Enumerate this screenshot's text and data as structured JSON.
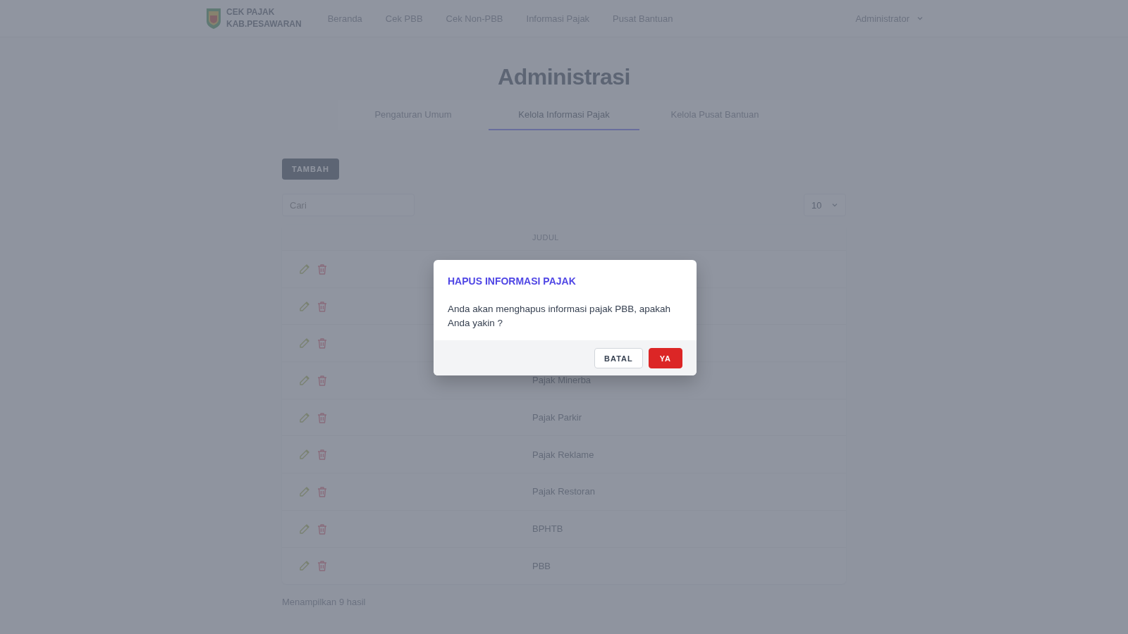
{
  "navbar": {
    "brand": [
      "CEK PAJAK",
      "KAB.PESAWARAN"
    ],
    "links": [
      "Beranda",
      "Cek PBB",
      "Cek Non-PBB",
      "Informasi Pajak",
      "Pusat Bantuan"
    ],
    "user": "Administrator"
  },
  "page_title": "Administrasi",
  "tabs": [
    {
      "label": "Pengaturan Umum",
      "selected": false
    },
    {
      "label": "Kelola Informasi Pajak",
      "selected": true
    },
    {
      "label": "Kelola Pusat Bantuan",
      "selected": false
    }
  ],
  "add_button": "TAMBAH",
  "search": {
    "placeholder": "Cari"
  },
  "page_size": "10",
  "table": {
    "columns": [
      "JUDUL"
    ],
    "rows": [
      {},
      {},
      {},
      {
        "title": "Pajak Minerba"
      },
      {
        "title": "Pajak Parkir"
      },
      {
        "title": "Pajak Reklame"
      },
      {
        "title": "Pajak Restoran"
      },
      {
        "title": "BPHTB"
      },
      {
        "title": "PBB"
      }
    ]
  },
  "result_count": "Menampilkan 9 hasil",
  "dialog": {
    "title": "HAPUS INFORMASI PAJAK",
    "message": "Anda akan menghapus informasi pajak PBB, apakah Anda yakin ?",
    "buttons": [
      {
        "label": "BATAL",
        "kind": "secondary"
      },
      {
        "label": "YA",
        "kind": "danger"
      }
    ]
  }
}
